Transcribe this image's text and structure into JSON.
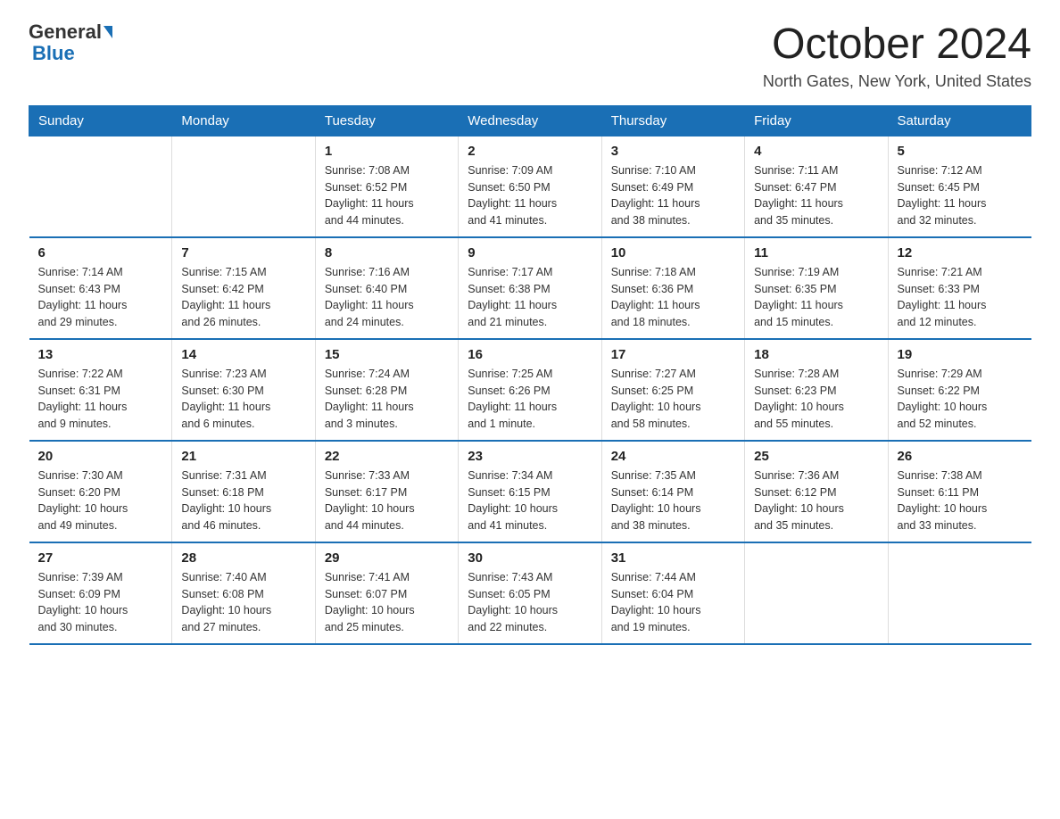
{
  "header": {
    "logo_general": "General",
    "logo_blue": "Blue",
    "month_title": "October 2024",
    "location": "North Gates, New York, United States"
  },
  "days_of_week": [
    "Sunday",
    "Monday",
    "Tuesday",
    "Wednesday",
    "Thursday",
    "Friday",
    "Saturday"
  ],
  "weeks": [
    [
      {
        "day": "",
        "info": ""
      },
      {
        "day": "",
        "info": ""
      },
      {
        "day": "1",
        "info": "Sunrise: 7:08 AM\nSunset: 6:52 PM\nDaylight: 11 hours\nand 44 minutes."
      },
      {
        "day": "2",
        "info": "Sunrise: 7:09 AM\nSunset: 6:50 PM\nDaylight: 11 hours\nand 41 minutes."
      },
      {
        "day": "3",
        "info": "Sunrise: 7:10 AM\nSunset: 6:49 PM\nDaylight: 11 hours\nand 38 minutes."
      },
      {
        "day": "4",
        "info": "Sunrise: 7:11 AM\nSunset: 6:47 PM\nDaylight: 11 hours\nand 35 minutes."
      },
      {
        "day": "5",
        "info": "Sunrise: 7:12 AM\nSunset: 6:45 PM\nDaylight: 11 hours\nand 32 minutes."
      }
    ],
    [
      {
        "day": "6",
        "info": "Sunrise: 7:14 AM\nSunset: 6:43 PM\nDaylight: 11 hours\nand 29 minutes."
      },
      {
        "day": "7",
        "info": "Sunrise: 7:15 AM\nSunset: 6:42 PM\nDaylight: 11 hours\nand 26 minutes."
      },
      {
        "day": "8",
        "info": "Sunrise: 7:16 AM\nSunset: 6:40 PM\nDaylight: 11 hours\nand 24 minutes."
      },
      {
        "day": "9",
        "info": "Sunrise: 7:17 AM\nSunset: 6:38 PM\nDaylight: 11 hours\nand 21 minutes."
      },
      {
        "day": "10",
        "info": "Sunrise: 7:18 AM\nSunset: 6:36 PM\nDaylight: 11 hours\nand 18 minutes."
      },
      {
        "day": "11",
        "info": "Sunrise: 7:19 AM\nSunset: 6:35 PM\nDaylight: 11 hours\nand 15 minutes."
      },
      {
        "day": "12",
        "info": "Sunrise: 7:21 AM\nSunset: 6:33 PM\nDaylight: 11 hours\nand 12 minutes."
      }
    ],
    [
      {
        "day": "13",
        "info": "Sunrise: 7:22 AM\nSunset: 6:31 PM\nDaylight: 11 hours\nand 9 minutes."
      },
      {
        "day": "14",
        "info": "Sunrise: 7:23 AM\nSunset: 6:30 PM\nDaylight: 11 hours\nand 6 minutes."
      },
      {
        "day": "15",
        "info": "Sunrise: 7:24 AM\nSunset: 6:28 PM\nDaylight: 11 hours\nand 3 minutes."
      },
      {
        "day": "16",
        "info": "Sunrise: 7:25 AM\nSunset: 6:26 PM\nDaylight: 11 hours\nand 1 minute."
      },
      {
        "day": "17",
        "info": "Sunrise: 7:27 AM\nSunset: 6:25 PM\nDaylight: 10 hours\nand 58 minutes."
      },
      {
        "day": "18",
        "info": "Sunrise: 7:28 AM\nSunset: 6:23 PM\nDaylight: 10 hours\nand 55 minutes."
      },
      {
        "day": "19",
        "info": "Sunrise: 7:29 AM\nSunset: 6:22 PM\nDaylight: 10 hours\nand 52 minutes."
      }
    ],
    [
      {
        "day": "20",
        "info": "Sunrise: 7:30 AM\nSunset: 6:20 PM\nDaylight: 10 hours\nand 49 minutes."
      },
      {
        "day": "21",
        "info": "Sunrise: 7:31 AM\nSunset: 6:18 PM\nDaylight: 10 hours\nand 46 minutes."
      },
      {
        "day": "22",
        "info": "Sunrise: 7:33 AM\nSunset: 6:17 PM\nDaylight: 10 hours\nand 44 minutes."
      },
      {
        "day": "23",
        "info": "Sunrise: 7:34 AM\nSunset: 6:15 PM\nDaylight: 10 hours\nand 41 minutes."
      },
      {
        "day": "24",
        "info": "Sunrise: 7:35 AM\nSunset: 6:14 PM\nDaylight: 10 hours\nand 38 minutes."
      },
      {
        "day": "25",
        "info": "Sunrise: 7:36 AM\nSunset: 6:12 PM\nDaylight: 10 hours\nand 35 minutes."
      },
      {
        "day": "26",
        "info": "Sunrise: 7:38 AM\nSunset: 6:11 PM\nDaylight: 10 hours\nand 33 minutes."
      }
    ],
    [
      {
        "day": "27",
        "info": "Sunrise: 7:39 AM\nSunset: 6:09 PM\nDaylight: 10 hours\nand 30 minutes."
      },
      {
        "day": "28",
        "info": "Sunrise: 7:40 AM\nSunset: 6:08 PM\nDaylight: 10 hours\nand 27 minutes."
      },
      {
        "day": "29",
        "info": "Sunrise: 7:41 AM\nSunset: 6:07 PM\nDaylight: 10 hours\nand 25 minutes."
      },
      {
        "day": "30",
        "info": "Sunrise: 7:43 AM\nSunset: 6:05 PM\nDaylight: 10 hours\nand 22 minutes."
      },
      {
        "day": "31",
        "info": "Sunrise: 7:44 AM\nSunset: 6:04 PM\nDaylight: 10 hours\nand 19 minutes."
      },
      {
        "day": "",
        "info": ""
      },
      {
        "day": "",
        "info": ""
      }
    ]
  ]
}
